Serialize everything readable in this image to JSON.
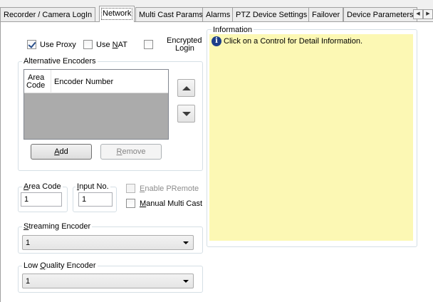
{
  "tabs": [
    {
      "label": "Recorder / Camera LogIn"
    },
    {
      "label": "Network"
    },
    {
      "label": "Multi Cast Params"
    },
    {
      "label": "Alarms"
    },
    {
      "label": "PTZ Device Settings"
    },
    {
      "label": "Failover"
    },
    {
      "label": "Device Parameters"
    }
  ],
  "tab_scroll": {
    "left": "◀",
    "right": "▶"
  },
  "options": {
    "use_proxy": {
      "label": "Use Proxy",
      "checked": true
    },
    "use_nat": {
      "label_pre": "Use ",
      "label_ul": "N",
      "label_post": "AT",
      "checked": false
    },
    "encrypted_login": {
      "label_line1": "Encrypted",
      "label_line2": "Login",
      "checked": false
    }
  },
  "alt_encoders": {
    "legend": "Alternative Encoders",
    "columns": {
      "area_code_line1": "Area",
      "area_code_line2": "Code",
      "encoder_number": "Encoder Number"
    },
    "add_button": {
      "ul": "A",
      "rest": "dd"
    },
    "remove_button": {
      "ul": "R",
      "rest": "emove"
    }
  },
  "area_code": {
    "legend_ul": "A",
    "legend_rest": "rea Code",
    "value": "1"
  },
  "input_no": {
    "legend_ul": "I",
    "legend_rest": "nput No.",
    "value": "1"
  },
  "enable_premote": {
    "ul": "E",
    "rest": "nable PRemote",
    "checked": false
  },
  "manual_multicast": {
    "ul": "M",
    "rest": "anual Multi Cast",
    "checked": false
  },
  "streaming_encoder": {
    "legend_ul": "S",
    "legend_rest": "treaming Encoder",
    "value": "1"
  },
  "low_quality_encoder": {
    "legend_pre": "Low ",
    "legend_ul": "Q",
    "legend_rest": "uality Encoder",
    "value": "1"
  },
  "information": {
    "legend": "Information",
    "icon": "info-icon",
    "text": "Click on a Control for Detail Information.",
    "background": "#fcf8b4"
  }
}
